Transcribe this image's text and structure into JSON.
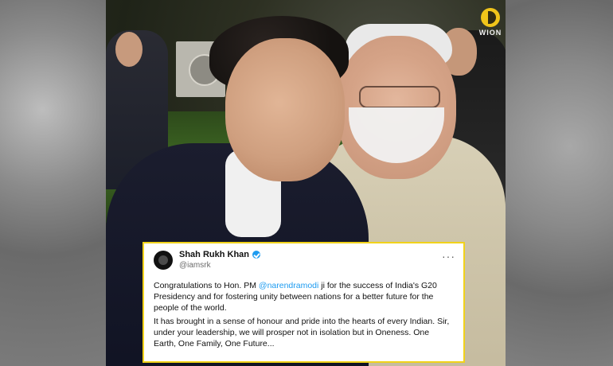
{
  "brand": {
    "logo_text": "WION",
    "logo_icon": "wion-logo-icon"
  },
  "tweet": {
    "author_name": "Shah Rukh Khan",
    "author_handle": "@iamsrk",
    "more_label": "···",
    "verified_icon": "verified-icon",
    "avatar_icon": "avatar-icon",
    "text_part1": "Congratulations to Hon. PM ",
    "mention": "@narendramodi",
    "text_part2": " ji for the success of India's G20 Presidency and for fostering unity between nations for a better future for the people of the world.",
    "text_para2": "It has brought in a sense of honour and pride into the hearts of every Indian. Sir, under your leadership, we will prosper not in isolation but in Oneness. One Earth, One Family, One Future..."
  }
}
